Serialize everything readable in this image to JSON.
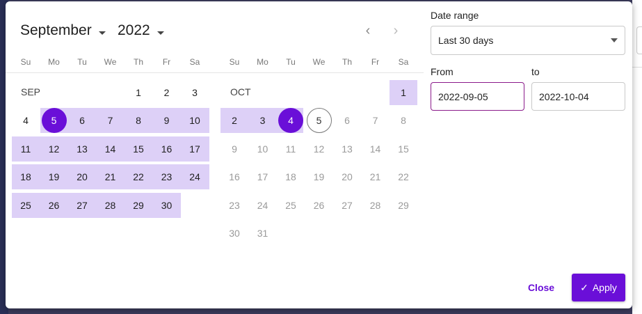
{
  "calendar": {
    "month_label": "September",
    "year_label": "2022",
    "prev_icon": "‹",
    "next_icon": "›",
    "weekdays": [
      "Su",
      "Mo",
      "Tu",
      "We",
      "Th",
      "Fr",
      "Sa"
    ],
    "left_month": {
      "label": "SEP",
      "days": [
        "1",
        "2",
        "3",
        "4",
        "5",
        "6",
        "7",
        "8",
        "9",
        "10",
        "11",
        "12",
        "13",
        "14",
        "15",
        "16",
        "17",
        "18",
        "19",
        "20",
        "21",
        "22",
        "23",
        "24",
        "25",
        "26",
        "27",
        "28",
        "29",
        "30"
      ]
    },
    "right_month": {
      "label": "OCT",
      "days": [
        "1",
        "2",
        "3",
        "4",
        "5",
        "6",
        "7",
        "8",
        "9",
        "10",
        "11",
        "12",
        "13",
        "14",
        "15",
        "16",
        "17",
        "18",
        "19",
        "20",
        "21",
        "22",
        "23",
        "24",
        "25",
        "26",
        "27",
        "28",
        "29",
        "30",
        "31"
      ]
    }
  },
  "panel": {
    "date_range_label": "Date range",
    "date_range_value": "Last 30 days",
    "from_label": "From",
    "to_label": "to",
    "from_value": "2022-09-05",
    "to_value": "2022-10-04"
  },
  "actions": {
    "close_label": "Close",
    "apply_label": "Apply",
    "apply_icon": "✓"
  },
  "colors": {
    "accent": "#6a0fd8",
    "range": "#ddd0f7"
  }
}
